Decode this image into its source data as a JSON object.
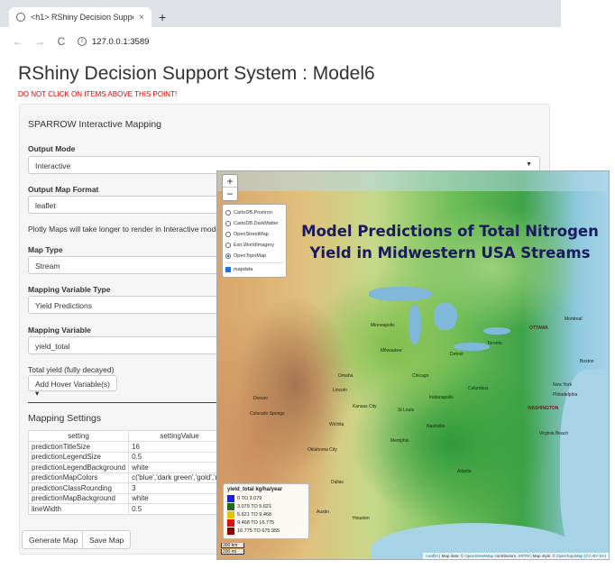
{
  "browser": {
    "tab_title": "<h1> RShiny Decision Support S",
    "tab_close": "×",
    "new_tab": "+",
    "back": "←",
    "forward": "→",
    "reload": "C",
    "url": "127.0.0.1:3589"
  },
  "page": {
    "title": "RShiny Decision Support System : Model6",
    "warning": "DO NOT CLICK ON ITEMS ABOVE THIS POINT!"
  },
  "panel": {
    "heading": "SPARROW Interactive Mapping",
    "output_mode": {
      "label": "Output Mode",
      "value": "Interactive"
    },
    "output_map_format": {
      "label": "Output Map Format",
      "value": "leaflet"
    },
    "plotly_note": "Plotly Maps will take longer to render in Interactive mode",
    "map_type": {
      "label": "Map Type",
      "value": "Stream"
    },
    "mapping_variable_type": {
      "label": "Mapping Variable Type",
      "value": "Yield Predictions"
    },
    "mapping_variable": {
      "label": "Mapping Variable",
      "value": "yield_total"
    },
    "variable_description": "Total yield (fully decayed)",
    "hover_button": "Add Hover Variable(s) ▾",
    "settings_heading": "Mapping Settings",
    "settings_columns": [
      "setting",
      "settingValue"
    ],
    "settings_rows": [
      {
        "setting": "predictionTitleSize",
        "value": "16"
      },
      {
        "setting": "predictionLegendSize",
        "value": "0.5"
      },
      {
        "setting": "predictionLegendBackground",
        "value": "white"
      },
      {
        "setting": "predictionMapColors",
        "value": "c('blue','dark green','gold','r"
      },
      {
        "setting": "predictionClassRounding",
        "value": "3"
      },
      {
        "setting": "predictionMapBackground",
        "value": "white"
      },
      {
        "setting": "lineWidth",
        "value": "0.5"
      }
    ],
    "generate_button": "Generate Map",
    "save_button": "Save Map"
  },
  "map": {
    "zoom_in": "+",
    "zoom_out": "−",
    "basemaps": [
      {
        "label": "CartoDB.Positron",
        "selected": false
      },
      {
        "label": "CartoDB.DarkMatter",
        "selected": false
      },
      {
        "label": "OpenStreetMap",
        "selected": false
      },
      {
        "label": "Esri.WorldImagery",
        "selected": false
      },
      {
        "label": "OpenTopoMap",
        "selected": true
      }
    ],
    "overlay": {
      "label": "mapdata",
      "checked": true
    },
    "title_line1": "Model Predictions of Total Nitrogen",
    "title_line2": "Yield in Midwestern USA Streams",
    "cities": {
      "minneapolis": "Minneapolis",
      "chicago": "Chicago",
      "detroit": "Detroit",
      "toronto": "Toronto",
      "ottawa": "OTTAWA",
      "montreal": "Montreal",
      "boston": "Boston",
      "newyork": "New York",
      "philadelphia": "Philadelphia",
      "washington": "WASHINGTON",
      "denver": "Denver",
      "kansascity": "Kansas City",
      "stlouis": "St Louis",
      "oklahoma": "Oklahoma City",
      "dallas": "Dallas",
      "houston": "Houston",
      "atlanta": "Atlanta",
      "nashville": "Nashville",
      "virginiabeach": "Virginia Beach",
      "wichita": "Wichita",
      "omaha": "Omaha",
      "coloradosprings": "Colorado Springs",
      "milwaukee": "Milwaukee",
      "indianapolis": "Indianapolis",
      "columbus": "Columbus",
      "memphis": "Memphis",
      "lincoln": "Lincoln",
      "austin": "Austin"
    },
    "legend": {
      "title": "yield_total kg/ha/year",
      "classes": [
        {
          "label": "0 TO 3.079",
          "color": "#1f1fd6"
        },
        {
          "label": "3.079 TO 5.621",
          "color": "#1b6b1b"
        },
        {
          "label": "5.621 TO 9.468",
          "color": "#e6c200"
        },
        {
          "label": "9.468 TO 16.775",
          "color": "#e01010"
        },
        {
          "label": "16.775 TO 675.955",
          "color": "#8b0000"
        }
      ]
    },
    "scale_km": "300 km",
    "scale_mi": "200 mi",
    "attribution_leaflet": "Leaflet",
    "attribution_text": " | Map data: © ",
    "attribution_osm": "OpenStreetMap",
    "attribution_mid": " contributors, ",
    "attribution_srtm": "SRTM",
    "attribution_style": " | Map style: © ",
    "attribution_otm": "OpenTopoMap (CC-BY-SA)"
  }
}
